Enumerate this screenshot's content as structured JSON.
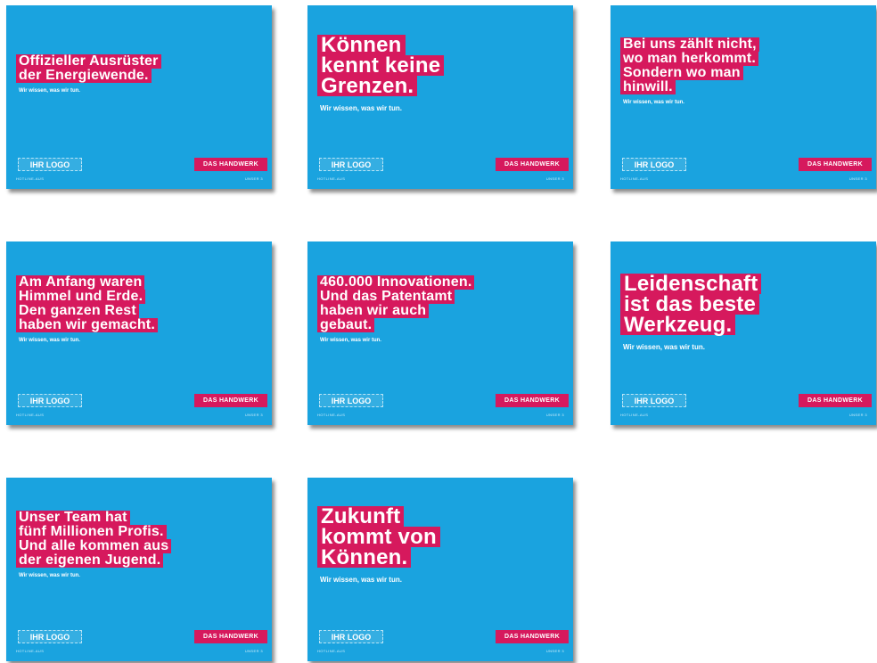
{
  "cards": [
    {
      "lines": [
        "Offizieller Ausrüster",
        "der Energiewende."
      ],
      "tagline": "Wir wissen, was wir tun.",
      "logo_label": "IHR LOGO",
      "brand_label": "DAS HANDWERK",
      "footer_left": "HOTLINE-AUS",
      "footer_right": "UNSER 3"
    },
    {
      "lines": [
        "Können",
        "kennt keine",
        "Grenzen."
      ],
      "tagline": "Wir wissen, was wir tun.",
      "logo_label": "IHR LOGO",
      "brand_label": "DAS HANDWERK",
      "footer_left": "HOTLINE-AUS",
      "footer_right": "UNSER 3"
    },
    {
      "lines": [
        "Bei uns zählt nicht,",
        "wo man herkommt.",
        "Sondern wo man",
        "hinwill."
      ],
      "tagline": "Wir wissen, was wir tun.",
      "logo_label": "IHR LOGO",
      "brand_label": "DAS HANDWERK",
      "footer_left": "HOTLINE-AUS",
      "footer_right": "UNSER 3"
    },
    {
      "lines": [
        "Am Anfang waren",
        "Himmel und Erde.",
        "Den ganzen Rest",
        "haben wir gemacht."
      ],
      "tagline": "Wir wissen, was wir tun.",
      "logo_label": "IHR LOGO",
      "brand_label": "DAS HANDWERK",
      "footer_left": "HOTLINE-AUS",
      "footer_right": "UNSER 3"
    },
    {
      "lines": [
        "460.000 Innovationen.",
        "Und das Patentamt",
        "haben wir auch",
        "gebaut."
      ],
      "tagline": "Wir wissen, was wir tun.",
      "logo_label": "IHR LOGO",
      "brand_label": "DAS HANDWERK",
      "footer_left": "HOTLINE-AUS",
      "footer_right": "UNSER 3"
    },
    {
      "lines": [
        "Leidenschaft",
        "ist das beste",
        "Werkzeug."
      ],
      "tagline": "Wir wissen, was wir tun.",
      "logo_label": "IHR LOGO",
      "brand_label": "DAS HANDWERK",
      "footer_left": "HOTLINE-AUS",
      "footer_right": "UNSER 3"
    },
    {
      "lines": [
        "Unser Team hat",
        "fünf Millionen Profis.",
        "Und alle kommen aus",
        "der eigenen Jugend."
      ],
      "tagline": "Wir wissen, was wir tun.",
      "logo_label": "IHR LOGO",
      "brand_label": "DAS HANDWERK",
      "footer_left": "HOTLINE-AUS",
      "footer_right": "UNSER 3"
    },
    {
      "lines": [
        "Zukunft",
        "kommt von",
        "Können."
      ],
      "tagline": "Wir wissen, was wir tun.",
      "logo_label": "IHR LOGO",
      "brand_label": "DAS HANDWERK",
      "footer_left": "HOTLINE-AUS",
      "footer_right": "UNSER 3"
    }
  ],
  "colors": {
    "card_background": "#1aa3df",
    "headline_highlight": "#d6195d",
    "text": "#ffffff"
  }
}
